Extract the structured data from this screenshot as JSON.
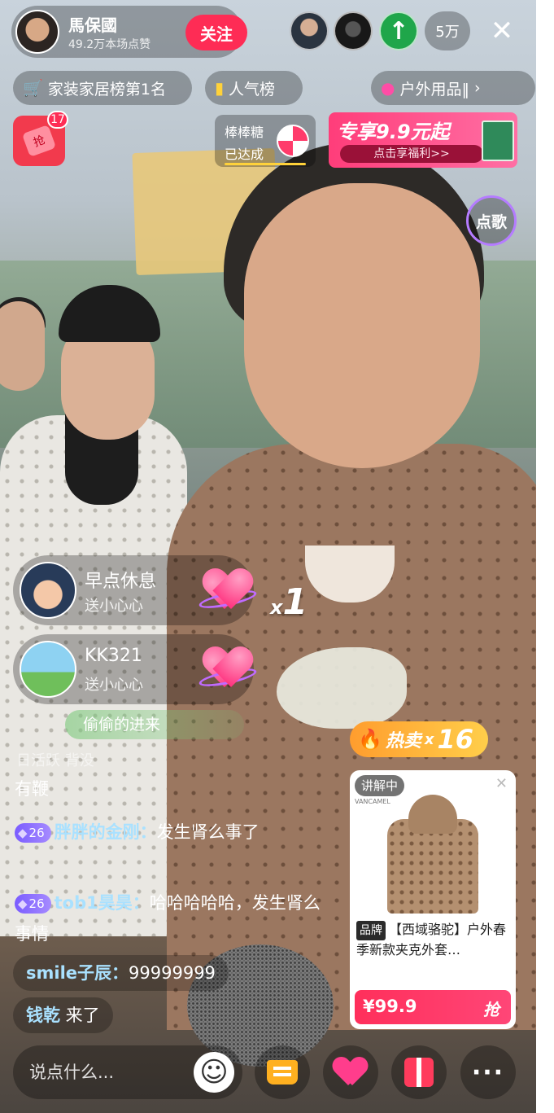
{
  "anchor": {
    "name": "馬保國",
    "likes": "49.2万本场点赞",
    "follow_label": "关注"
  },
  "viewers": {
    "count": "5万",
    "icons": [
      "viewer-avatar",
      "viewer-avatar",
      "up-arrow-icon"
    ]
  },
  "close_glyph": "✕",
  "chips": {
    "rank": "家装家居榜第1名",
    "popular": "人气榜",
    "category": "户外用品‖"
  },
  "redpack": {
    "badge": "17",
    "seal": "抢"
  },
  "candy_task": {
    "name": "棒棒糖",
    "status": "已达成"
  },
  "promo": {
    "headline": "专享9.9元起",
    "cta": "点击享福利>>"
  },
  "song_label": "点歌",
  "gifts": [
    {
      "user": "早点休息",
      "action": "送小心心"
    },
    {
      "user": "KK321",
      "action": "送小心心"
    }
  ],
  "combo": {
    "prefix": "x",
    "value": "1"
  },
  "enter_notice": "偷偷的进来",
  "chat": {
    "faded": "日活跃   背没",
    "line_a": "有鞭",
    "line_b": {
      "level": "26",
      "user": "胖胖的金刚：",
      "text": "发生肾么事了"
    },
    "line_c": {
      "level": "26",
      "user": "tob1昊昊：",
      "text": "哈哈哈哈哈，发生肾么事情"
    },
    "line_d": {
      "user": "smile子辰：",
      "text": "99999999"
    },
    "line_e": {
      "user": "钱乾",
      "text": " 来了"
    }
  },
  "hot_sale": {
    "label": "热卖",
    "prefix": "x",
    "count": "16"
  },
  "product": {
    "tag": "讲解中",
    "brandmark": "VANCAMEL",
    "brand_badge": "品牌",
    "title": "【西域骆驼】户外春季新款夹克外套…",
    "price": "¥99.9",
    "grab": "抢"
  },
  "bottom": {
    "input_placeholder": "说点什么...",
    "icons": [
      "emoji-icon",
      "cart-icon",
      "like-icon",
      "gift-icon",
      "more-icon"
    ]
  },
  "colors": {
    "accent": "#fe2c55",
    "username": "#a9e1ff",
    "level": "#7a5cff",
    "hot": "#ffb020"
  }
}
